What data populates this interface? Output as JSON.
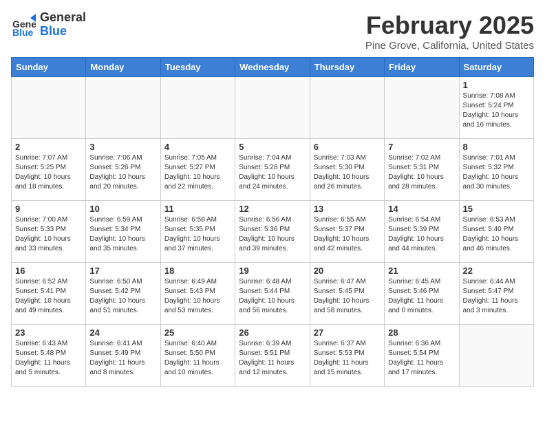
{
  "header": {
    "logo_general": "General",
    "logo_blue": "Blue",
    "month_title": "February 2025",
    "location": "Pine Grove, California, United States"
  },
  "weekdays": [
    "Sunday",
    "Monday",
    "Tuesday",
    "Wednesday",
    "Thursday",
    "Friday",
    "Saturday"
  ],
  "weeks": [
    [
      {
        "day": "",
        "info": ""
      },
      {
        "day": "",
        "info": ""
      },
      {
        "day": "",
        "info": ""
      },
      {
        "day": "",
        "info": ""
      },
      {
        "day": "",
        "info": ""
      },
      {
        "day": "",
        "info": ""
      },
      {
        "day": "1",
        "info": "Sunrise: 7:08 AM\nSunset: 5:24 PM\nDaylight: 10 hours\nand 16 minutes."
      }
    ],
    [
      {
        "day": "2",
        "info": "Sunrise: 7:07 AM\nSunset: 5:25 PM\nDaylight: 10 hours\nand 18 minutes."
      },
      {
        "day": "3",
        "info": "Sunrise: 7:06 AM\nSunset: 5:26 PM\nDaylight: 10 hours\nand 20 minutes."
      },
      {
        "day": "4",
        "info": "Sunrise: 7:05 AM\nSunset: 5:27 PM\nDaylight: 10 hours\nand 22 minutes."
      },
      {
        "day": "5",
        "info": "Sunrise: 7:04 AM\nSunset: 5:28 PM\nDaylight: 10 hours\nand 24 minutes."
      },
      {
        "day": "6",
        "info": "Sunrise: 7:03 AM\nSunset: 5:30 PM\nDaylight: 10 hours\nand 26 minutes."
      },
      {
        "day": "7",
        "info": "Sunrise: 7:02 AM\nSunset: 5:31 PM\nDaylight: 10 hours\nand 28 minutes."
      },
      {
        "day": "8",
        "info": "Sunrise: 7:01 AM\nSunset: 5:32 PM\nDaylight: 10 hours\nand 30 minutes."
      }
    ],
    [
      {
        "day": "9",
        "info": "Sunrise: 7:00 AM\nSunset: 5:33 PM\nDaylight: 10 hours\nand 33 minutes."
      },
      {
        "day": "10",
        "info": "Sunrise: 6:59 AM\nSunset: 5:34 PM\nDaylight: 10 hours\nand 35 minutes."
      },
      {
        "day": "11",
        "info": "Sunrise: 6:58 AM\nSunset: 5:35 PM\nDaylight: 10 hours\nand 37 minutes."
      },
      {
        "day": "12",
        "info": "Sunrise: 6:56 AM\nSunset: 5:36 PM\nDaylight: 10 hours\nand 39 minutes."
      },
      {
        "day": "13",
        "info": "Sunrise: 6:55 AM\nSunset: 5:37 PM\nDaylight: 10 hours\nand 42 minutes."
      },
      {
        "day": "14",
        "info": "Sunrise: 6:54 AM\nSunset: 5:39 PM\nDaylight: 10 hours\nand 44 minutes."
      },
      {
        "day": "15",
        "info": "Sunrise: 6:53 AM\nSunset: 5:40 PM\nDaylight: 10 hours\nand 46 minutes."
      }
    ],
    [
      {
        "day": "16",
        "info": "Sunrise: 6:52 AM\nSunset: 5:41 PM\nDaylight: 10 hours\nand 49 minutes."
      },
      {
        "day": "17",
        "info": "Sunrise: 6:50 AM\nSunset: 5:42 PM\nDaylight: 10 hours\nand 51 minutes."
      },
      {
        "day": "18",
        "info": "Sunrise: 6:49 AM\nSunset: 5:43 PM\nDaylight: 10 hours\nand 53 minutes."
      },
      {
        "day": "19",
        "info": "Sunrise: 6:48 AM\nSunset: 5:44 PM\nDaylight: 10 hours\nand 56 minutes."
      },
      {
        "day": "20",
        "info": "Sunrise: 6:47 AM\nSunset: 5:45 PM\nDaylight: 10 hours\nand 58 minutes."
      },
      {
        "day": "21",
        "info": "Sunrise: 6:45 AM\nSunset: 5:46 PM\nDaylight: 11 hours\nand 0 minutes."
      },
      {
        "day": "22",
        "info": "Sunrise: 6:44 AM\nSunset: 5:47 PM\nDaylight: 11 hours\nand 3 minutes."
      }
    ],
    [
      {
        "day": "23",
        "info": "Sunrise: 6:43 AM\nSunset: 5:48 PM\nDaylight: 11 hours\nand 5 minutes."
      },
      {
        "day": "24",
        "info": "Sunrise: 6:41 AM\nSunset: 5:49 PM\nDaylight: 11 hours\nand 8 minutes."
      },
      {
        "day": "25",
        "info": "Sunrise: 6:40 AM\nSunset: 5:50 PM\nDaylight: 11 hours\nand 10 minutes."
      },
      {
        "day": "26",
        "info": "Sunrise: 6:39 AM\nSunset: 5:51 PM\nDaylight: 11 hours\nand 12 minutes."
      },
      {
        "day": "27",
        "info": "Sunrise: 6:37 AM\nSunset: 5:53 PM\nDaylight: 11 hours\nand 15 minutes."
      },
      {
        "day": "28",
        "info": "Sunrise: 6:36 AM\nSunset: 5:54 PM\nDaylight: 11 hours\nand 17 minutes."
      },
      {
        "day": "",
        "info": ""
      }
    ]
  ]
}
